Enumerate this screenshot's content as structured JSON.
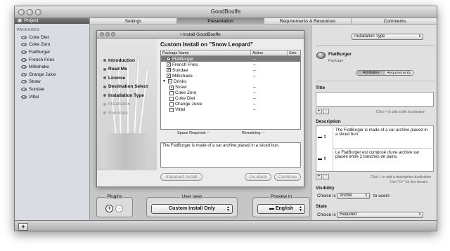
{
  "window": {
    "title": "GoodBouffe"
  },
  "tabs": [
    {
      "label": "Settings"
    },
    {
      "label": "Presentation"
    },
    {
      "label": "Requirements & Resources"
    },
    {
      "label": "Comments"
    }
  ],
  "sidebar": {
    "header": "Project",
    "section": "PACKAGES",
    "items": [
      "Coke Diet",
      "Coke Zero",
      "FlatBurger",
      "French Fries",
      "Milkshake",
      "Orange Juice",
      "Straw",
      "Sundae",
      "Vittel"
    ]
  },
  "installer": {
    "title": "Install GoodBouffe",
    "heading": "Custom Install on \"Snow Leopard\"",
    "steps": [
      {
        "label": "Introduction",
        "enabled": true
      },
      {
        "label": "Read Me",
        "enabled": true
      },
      {
        "label": "License",
        "enabled": true
      },
      {
        "label": "Destination Select",
        "enabled": true
      },
      {
        "label": "Installation Type",
        "enabled": true
      },
      {
        "label": "Installation",
        "enabled": false
      },
      {
        "label": "Summary",
        "enabled": false
      }
    ],
    "columns": [
      "Package Name",
      "Action",
      "Size"
    ],
    "packages": [
      {
        "name": "FlatBurger",
        "check": "✓",
        "action": "–",
        "level": 0,
        "selected": true
      },
      {
        "name": "French Fries",
        "check": "✓",
        "action": "–",
        "level": 0
      },
      {
        "name": "Sundae",
        "check": "✓",
        "action": "–",
        "level": 0
      },
      {
        "name": "Milkshake",
        "check": "✓",
        "action": "–",
        "level": 0
      },
      {
        "name": "Drinks",
        "check": "–",
        "action": "",
        "level": 0,
        "group": true
      },
      {
        "name": "Straw",
        "check": "✓",
        "action": "–",
        "level": 1
      },
      {
        "name": "Coke Zero",
        "check": "",
        "action": "–",
        "level": 1
      },
      {
        "name": "Coke Diet",
        "check": "",
        "action": "–",
        "level": 1
      },
      {
        "name": "Orange Juice",
        "check": "",
        "action": "–",
        "level": 1
      },
      {
        "name": "Vittel",
        "check": "",
        "action": "–",
        "level": 1
      }
    ],
    "space_required": "Space Required:  –",
    "remaining": "Remaining:  –",
    "description": "The FlatBurger is made of a xar archive placed in a sliced bun.",
    "buttons": {
      "standard": "Standard Install",
      "back": "Go Back",
      "continue": "Continue"
    }
  },
  "bottom_panels": {
    "plugins_label": "Plugins",
    "user_sees_label": "User sees",
    "user_sees_value": "Custom Install Only",
    "preview_label": "Preview in",
    "preview_value": "English"
  },
  "inspector": {
    "type_popup": "Installation Type",
    "package_name": "FlatBurger",
    "package_kind": "Package",
    "seg_attributes": "Attributes",
    "seg_requirements": "Requirements",
    "title_label": "Title",
    "title_hint": "Click + to add a title localization",
    "description_label": "Description",
    "desc_en": "The FlatBurger is made of a xar archive placed in a sliced bun.",
    "desc_fr": "Le FlatBurger est composé d'une archive xar placée entre 2 tranches de pains.",
    "desc_hint": "Click + to add a description localization",
    "desc_hint2": "Use \"C=\" for line breaks",
    "visibility_label": "Visibility",
    "choice_is": "Choice is",
    "visibility_value": "Visible",
    "to_users": "to users",
    "state_label": "State",
    "state_value": "Required"
  }
}
